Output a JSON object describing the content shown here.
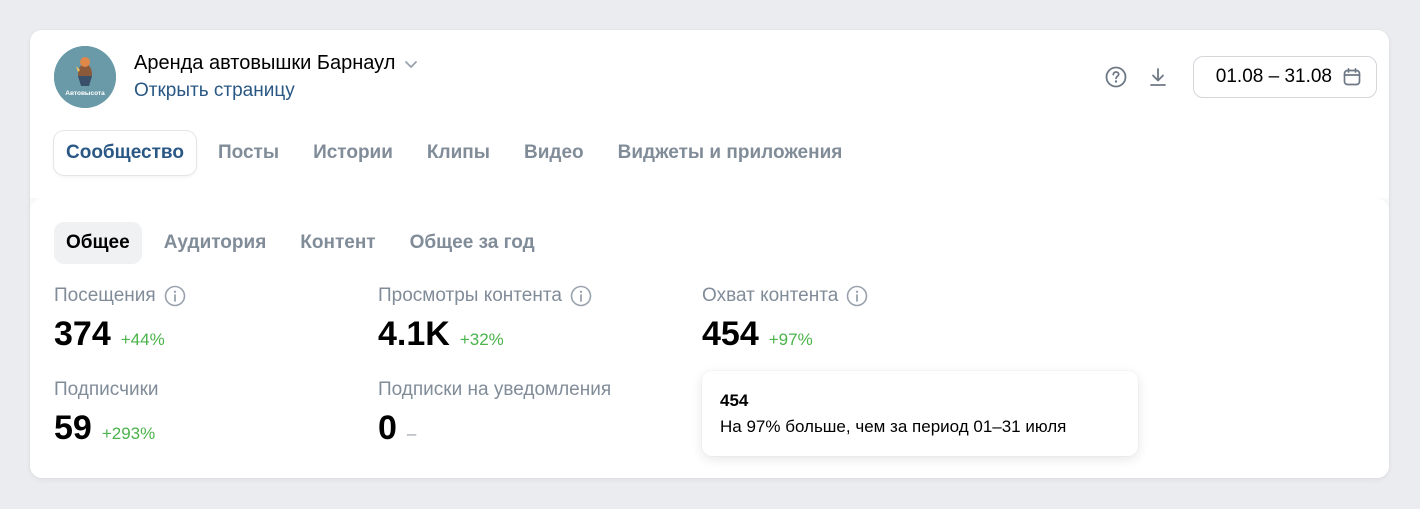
{
  "group": {
    "name": "Аренда автовышки Барнаул",
    "open_link": "Открыть страницу",
    "avatar_text": "Автовысота"
  },
  "header": {
    "date_range": "01.08 – 31.08",
    "help_icon": "question-circle-icon",
    "download_icon": "download-icon",
    "calendar_icon": "calendar-icon"
  },
  "tabs": [
    {
      "label": "Сообщество",
      "active": true
    },
    {
      "label": "Посты",
      "active": false
    },
    {
      "label": "Истории",
      "active": false
    },
    {
      "label": "Клипы",
      "active": false
    },
    {
      "label": "Видео",
      "active": false
    },
    {
      "label": "Виджеты и приложения",
      "active": false
    }
  ],
  "subtabs": [
    {
      "label": "Общее",
      "active": true
    },
    {
      "label": "Аудитория",
      "active": false
    },
    {
      "label": "Контент",
      "active": false
    },
    {
      "label": "Общее за год",
      "active": false
    }
  ],
  "metrics": {
    "visits": {
      "label": "Посещения",
      "value": "374",
      "delta": "+44%"
    },
    "views": {
      "label": "Просмотры контента",
      "value": "4.1K",
      "delta": "+32%"
    },
    "reach": {
      "label": "Охват контента",
      "value": "454",
      "delta": "+97%"
    },
    "subscribers": {
      "label": "Подписчики",
      "value": "59",
      "delta": "+293%"
    },
    "notifications": {
      "label": "Подписки на уведомления",
      "value": "0",
      "delta": "–"
    }
  },
  "tooltip": {
    "value": "454",
    "text": "На 97% больше, чем за период 01–31 июля"
  },
  "colors": {
    "accent": "#2a5885",
    "positive": "#4bb34b",
    "muted": "#818c99",
    "background": "#ebecef"
  }
}
